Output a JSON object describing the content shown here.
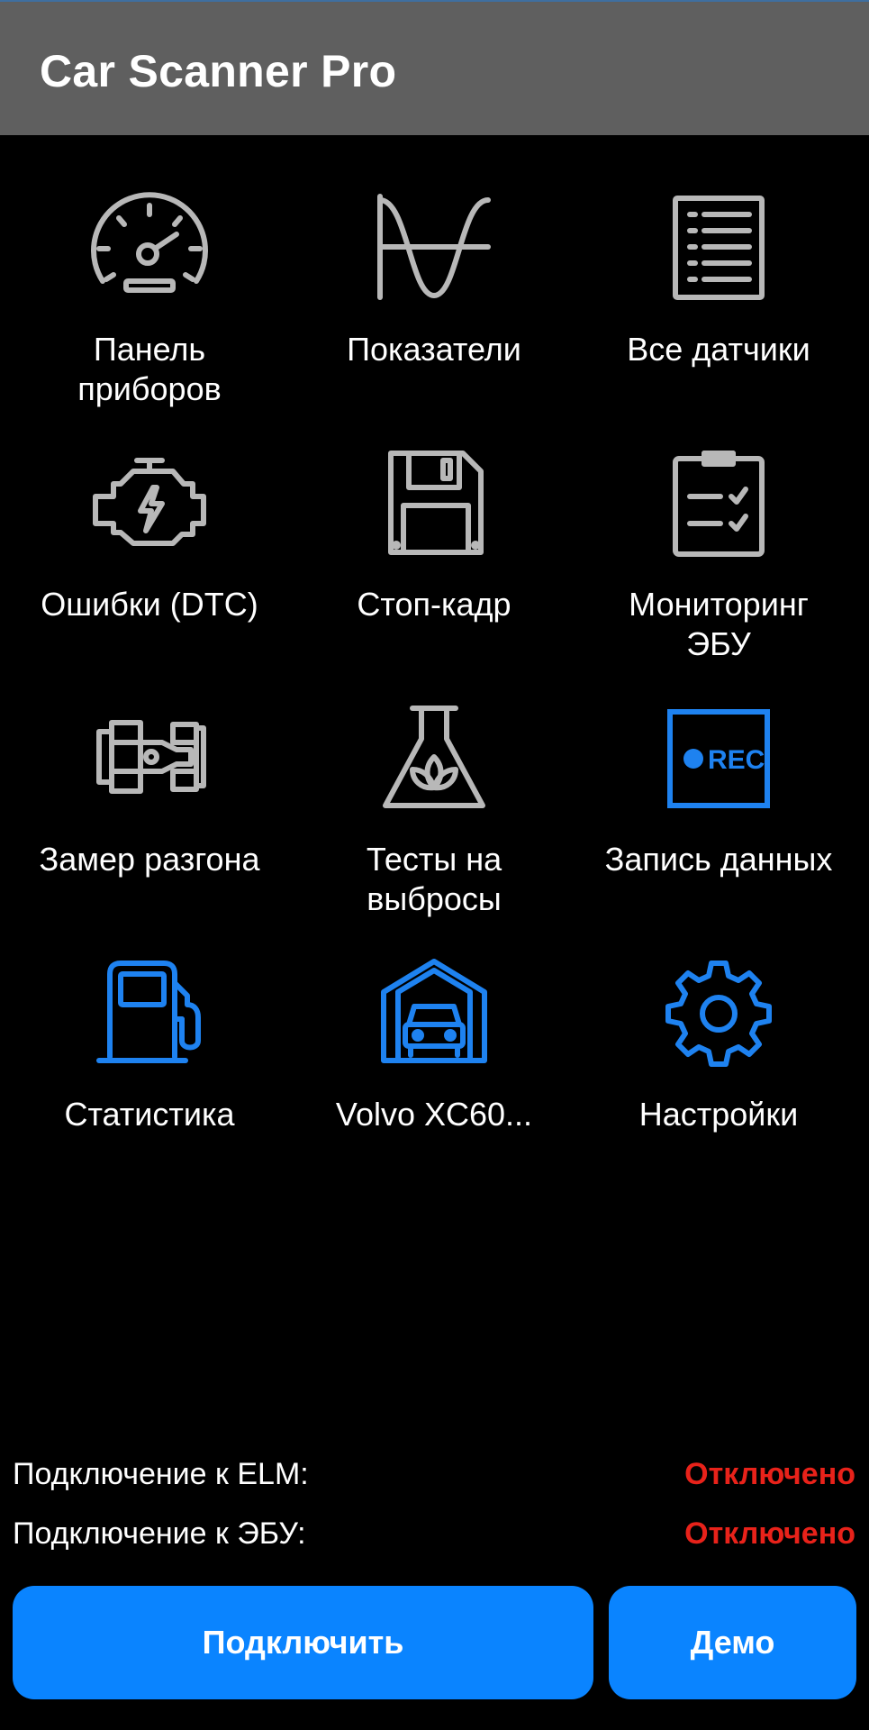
{
  "app": {
    "title": "Car Scanner Pro"
  },
  "colors": {
    "appbar": "#5f5f5f",
    "accent": "#0a84ff",
    "icon_gray": "#b8b8b8",
    "icon_blue": "#1e82f0",
    "status_off": "#e8221a"
  },
  "tiles": [
    {
      "label": "Панель\nприборов",
      "icon": "speedometer-icon"
    },
    {
      "label": "Показатели",
      "icon": "sine-wave-icon"
    },
    {
      "label": "Все датчики",
      "icon": "list-icon"
    },
    {
      "label": "Ошибки (DTC)",
      "icon": "engine-check-icon"
    },
    {
      "label": "Стоп-кадр",
      "icon": "floppy-disk-icon"
    },
    {
      "label": "Мониторинг\nЭБУ",
      "icon": "clipboard-check-icon"
    },
    {
      "label": "Замер разгона",
      "icon": "race-car-icon"
    },
    {
      "label": "Тесты на\nвыбросы",
      "icon": "flask-leaf-icon"
    },
    {
      "label": "Запись данных",
      "icon": "rec-icon",
      "rec_text": "REC"
    },
    {
      "label": "Статистика",
      "icon": "fuel-pump-icon"
    },
    {
      "label": "Volvo XC60...",
      "icon": "garage-car-icon"
    },
    {
      "label": "Настройки",
      "icon": "gear-icon"
    }
  ],
  "status": {
    "elm": {
      "label": "Подключение к ELM:",
      "value": "Отключено"
    },
    "ecu": {
      "label": "Подключение к ЭБУ:",
      "value": "Отключено"
    }
  },
  "buttons": {
    "connect": "Подключить",
    "demo": "Демо"
  }
}
